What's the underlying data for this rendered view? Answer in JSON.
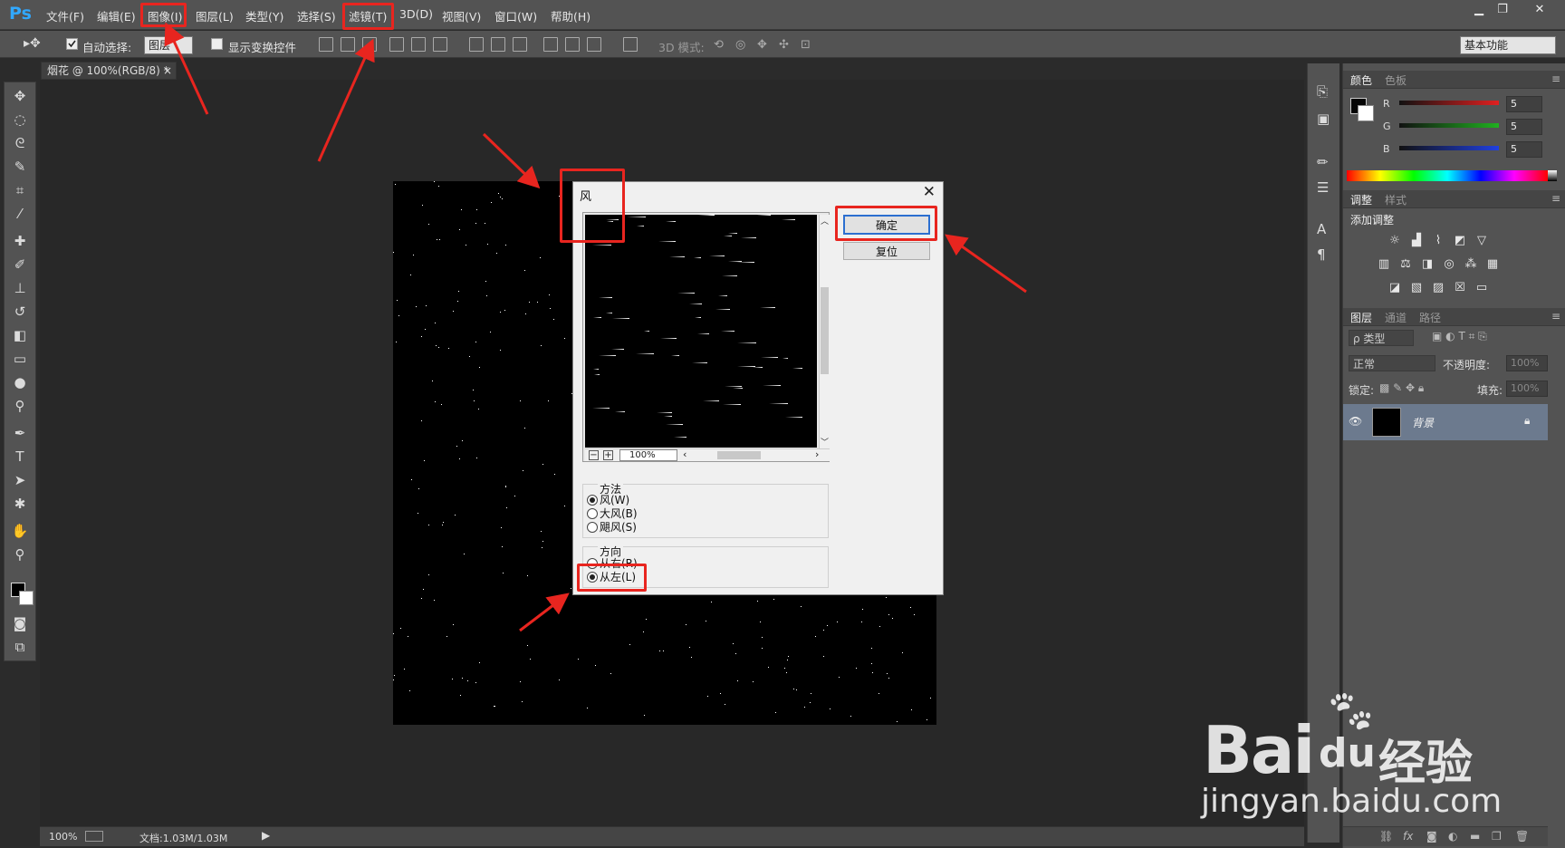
{
  "app": {
    "logo": "Ps"
  },
  "menu": [
    "文件(F)",
    "编辑(E)",
    "图像(I)",
    "图层(L)",
    "类型(Y)",
    "选择(S)",
    "滤镜(T)",
    "3D(D)",
    "视图(V)",
    "窗口(W)",
    "帮助(H)"
  ],
  "window_controls": {
    "minimize": "▁",
    "restore": "❐",
    "close": "✕"
  },
  "options": {
    "auto_select_label": "自动选择:",
    "auto_select_value": "图层",
    "show_transform_label": "显示变换控件",
    "mode_3d_label": "3D 模式:",
    "workspace": "基本功能"
  },
  "document": {
    "tab_title": "烟花 @ 100%(RGB/8) *",
    "tab_close": "×"
  },
  "status": {
    "zoom": "100%",
    "doc_info": "文档:1.03M/1.03M"
  },
  "color_panel": {
    "tabs": [
      "颜色",
      "色板"
    ],
    "channels": [
      {
        "label": "R",
        "value": "5",
        "color": "#e02020"
      },
      {
        "label": "G",
        "value": "5",
        "color": "#20b020"
      },
      {
        "label": "B",
        "value": "5",
        "color": "#2040e0"
      }
    ]
  },
  "adjust_panel": {
    "tabs": [
      "调整",
      "样式"
    ],
    "heading": "添加调整"
  },
  "layers_panel": {
    "tabs": [
      "图层",
      "通道",
      "路径"
    ],
    "filter_label": "ρ 类型",
    "blend_mode": "正常",
    "opacity_label": "不透明度:",
    "opacity_value": "100%",
    "lock_label": "锁定:",
    "fill_label": "填充:",
    "fill_value": "100%",
    "layer_name": "背景"
  },
  "dialog": {
    "title": "风",
    "ok": "确定",
    "reset": "复位",
    "zoom": "100%",
    "method_label": "方法",
    "methods": [
      "风(W)",
      "大风(B)",
      "飓风(S)"
    ],
    "method_selected": 0,
    "direction_label": "方向",
    "directions": [
      "从右(R)",
      "从左(L)"
    ],
    "direction_selected": 1
  },
  "watermark": {
    "brand_a": "Bai",
    "brand_b": "du",
    "brand_cn": "经验",
    "url": "jingyan.baidu.com"
  }
}
